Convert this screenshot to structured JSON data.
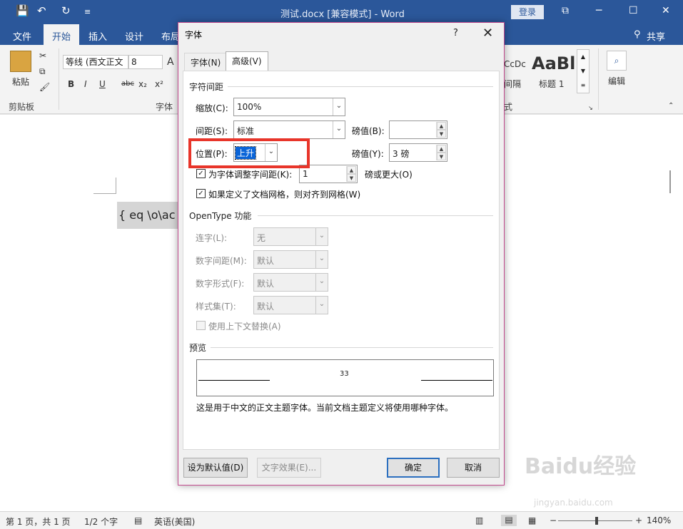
{
  "window": {
    "title": "测试.docx [兼容模式] - Word",
    "login_label": "登录",
    "share_label": "共享",
    "qat": {
      "save": "💾",
      "undo": "↶",
      "redo": "↻",
      "more": "≡"
    },
    "controls": {
      "ribbon_display": "⧉",
      "minimize": "─",
      "maximize": "☐",
      "close": "✕"
    }
  },
  "ribbon_tabs": [
    "文件",
    "开始",
    "插入",
    "设计",
    "布局"
  ],
  "ribbon": {
    "paste_label": "粘贴",
    "clipboard_label": "剪贴板",
    "font_group_label": "字体",
    "font_name": "等线 (西文正文",
    "font_size": "8",
    "styles_group_label": "式",
    "style_heading1_preview": "AaBl",
    "style_heading1_label": "标题 1",
    "style_prev_preview": "CcDc",
    "style_prev_label": "间隔",
    "edit_label": "编辑",
    "format_buttons": [
      "B",
      "I",
      "U",
      "abc",
      "x₂",
      "x²"
    ],
    "grow_font": "A"
  },
  "document": {
    "field_text": "{ eq \\o\\ac"
  },
  "statusbar": {
    "page": "第 1 页，共 1 页",
    "words": "1/2 个字",
    "language": "英语(美国)",
    "zoom": "140%",
    "zoom_minus": "−",
    "zoom_plus": "+"
  },
  "dialog": {
    "title": "字体",
    "help": "?",
    "close": "✕",
    "tabs": [
      "字体(N)",
      "高级(V)"
    ],
    "spacing_section": "字符间距",
    "scale_label": "缩放(C):",
    "scale_value": "100%",
    "spacing_label": "间距(S):",
    "spacing_value": "标准",
    "spacing_by_label": "磅值(B):",
    "spacing_by_value": "",
    "position_label": "位置(P):",
    "position_value": "上升",
    "position_by_label": "磅值(Y):",
    "position_by_value": "3 磅",
    "kerning_label": "为字体调整字间距(K):",
    "kerning_value": "1",
    "kerning_suffix": "磅或更大(O)",
    "kerning_checked": true,
    "grid_label": "如果定义了文档网格，则对齐到网格(W)",
    "grid_checked": true,
    "opentype_section": "OpenType 功能",
    "ligature_label": "连字(L):",
    "ligature_value": "无",
    "num_spacing_label": "数字间距(M):",
    "num_spacing_value": "默认",
    "num_form_label": "数字形式(F):",
    "num_form_value": "默认",
    "style_set_label": "样式集(T):",
    "style_set_value": "默认",
    "contextual_label": "使用上下文替换(A)",
    "preview_section": "预览",
    "preview_text": "33",
    "preview_note": "这是用于中文的正文主题字体。当前文档主题定义将使用哪种字体。",
    "set_default_btn": "设为默认值(D)",
    "text_effects_btn": "文字效果(E)...",
    "ok_btn": "确定",
    "cancel_btn": "取消"
  },
  "watermark": {
    "brand": "Baidu经验",
    "url": "jingyan.baidu.com"
  },
  "colors": {
    "accent": "#2b579a",
    "highlight_box": "#e8352a",
    "dialog_border": "#c24a8e"
  }
}
